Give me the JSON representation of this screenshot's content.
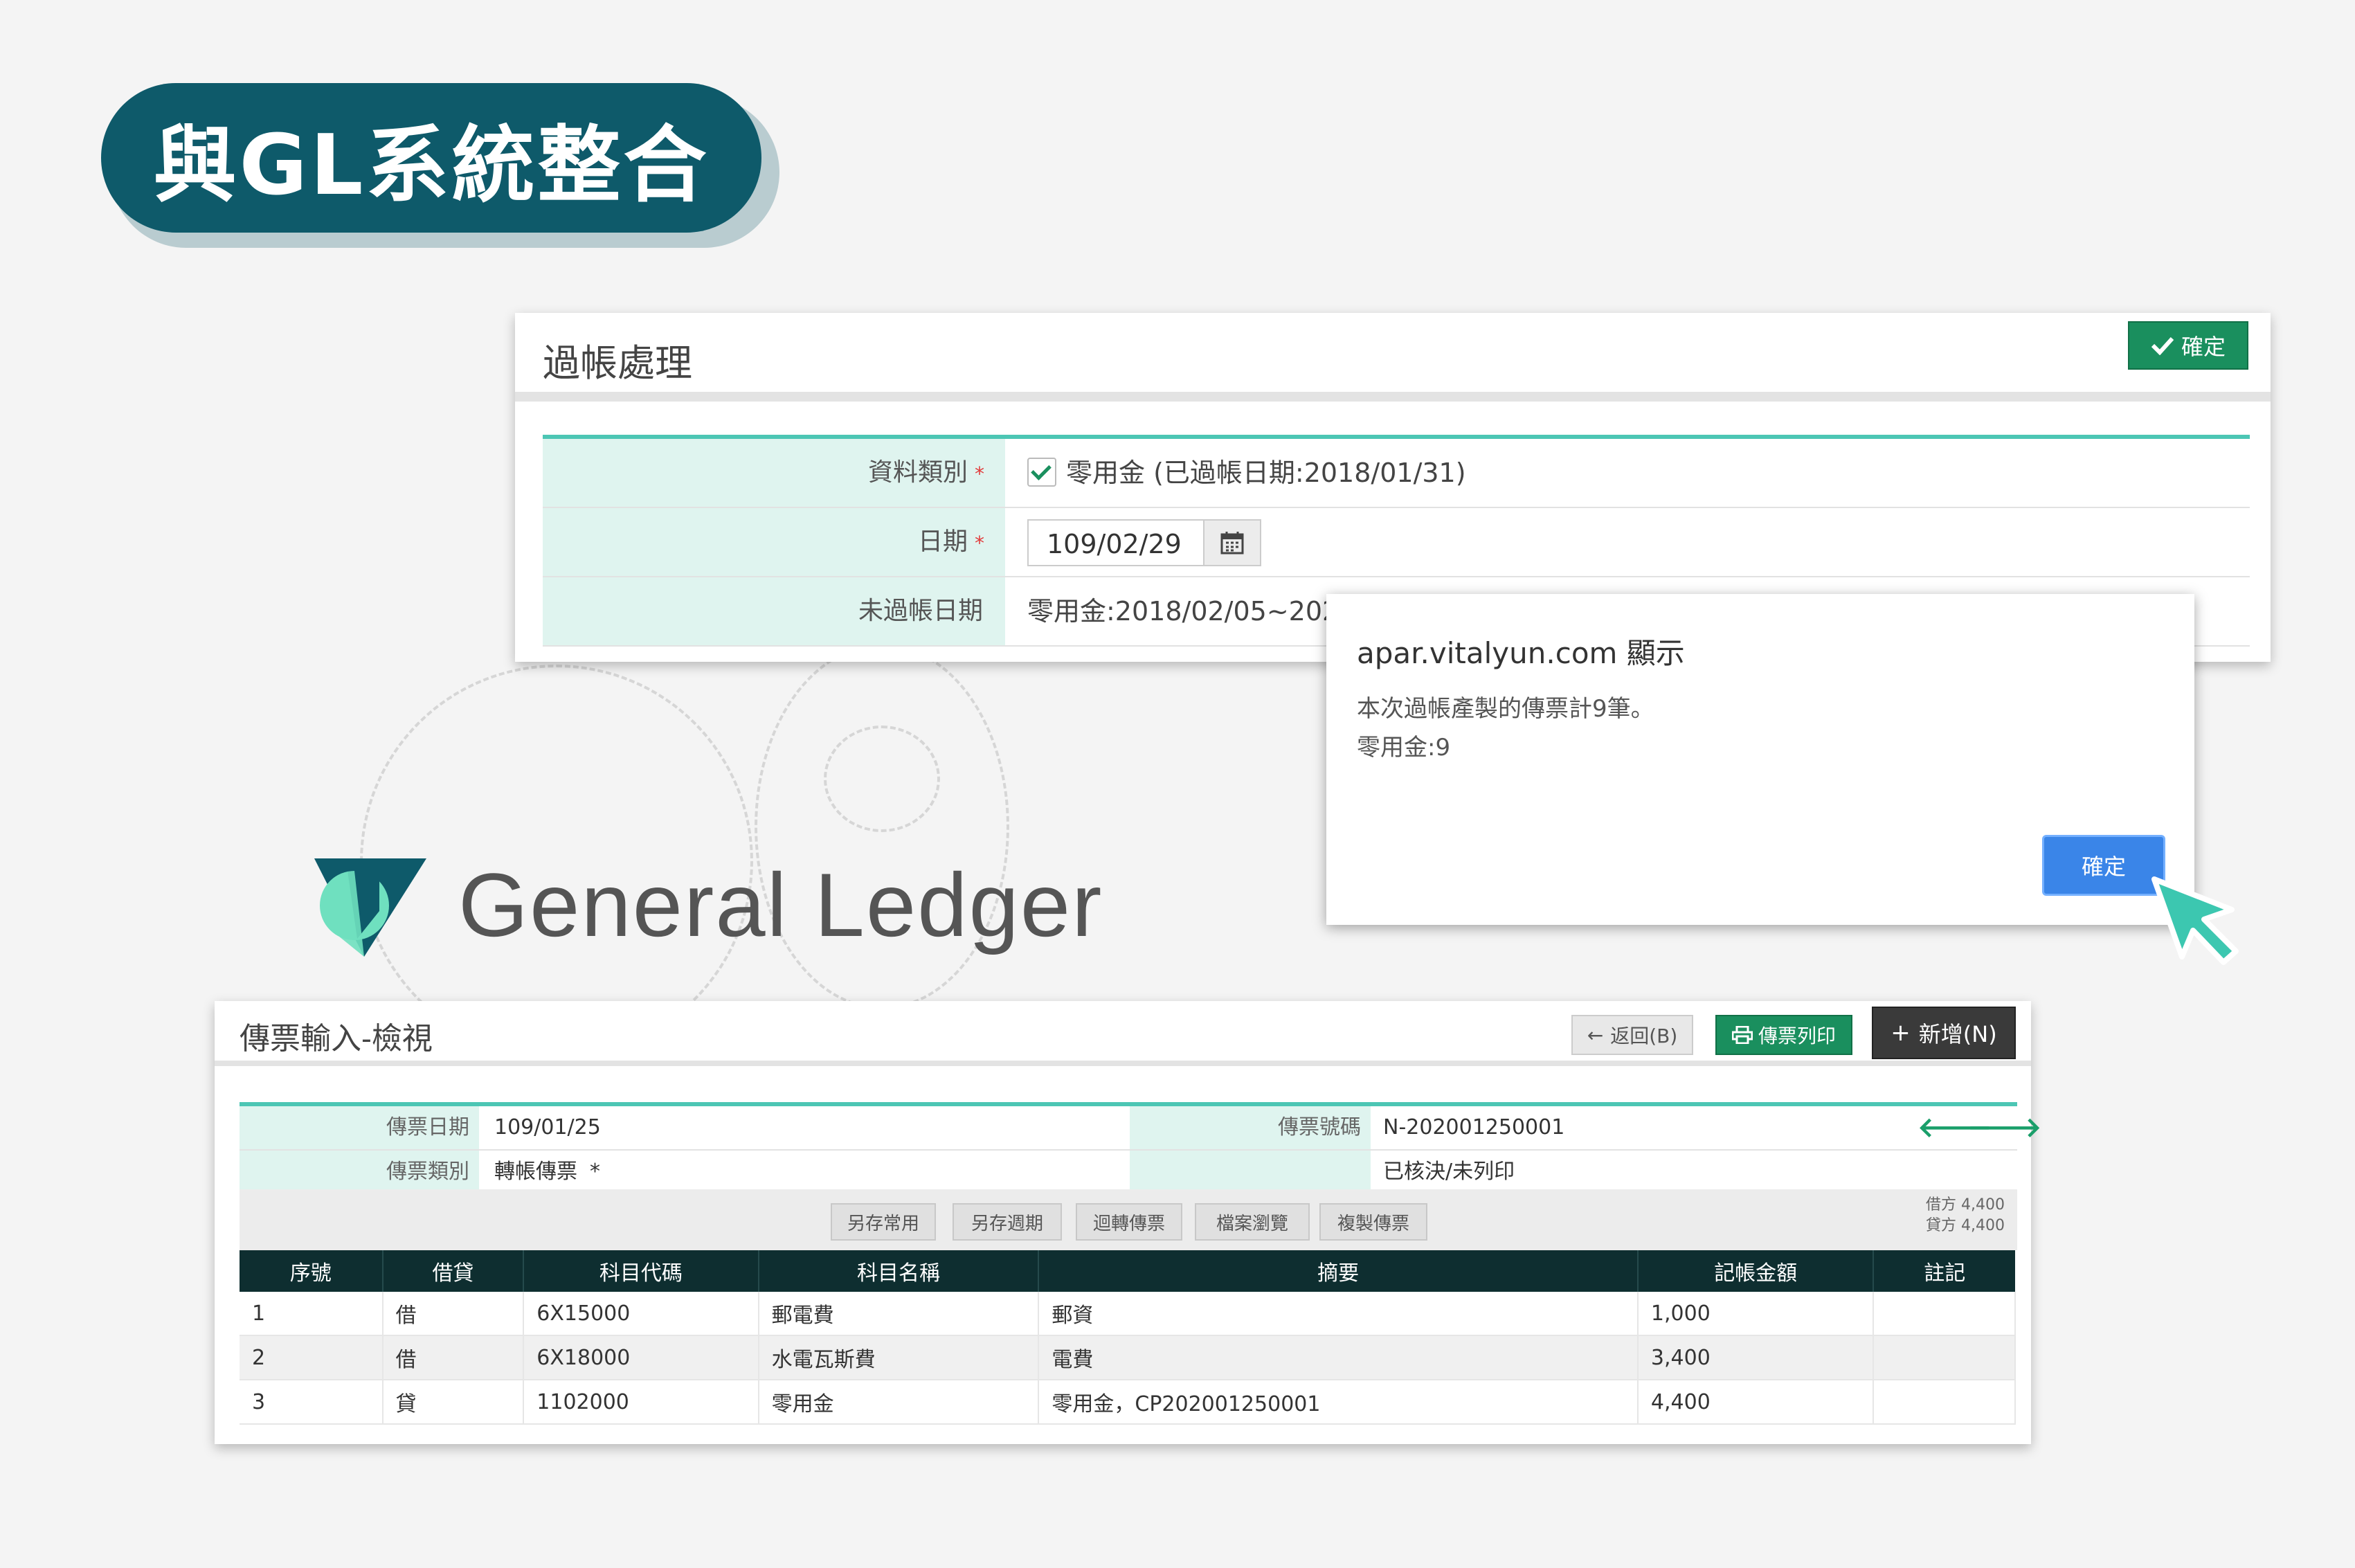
{
  "banner": {
    "title": "與GL系統整合"
  },
  "posting_panel": {
    "title": "過帳處理",
    "confirm_button": "確定",
    "fields": [
      {
        "label": "資料類別",
        "required": true,
        "value": "零用金 (已過帳日期:2018/01/31)",
        "checked": true
      },
      {
        "label": "日期",
        "required": true,
        "value": "109/02/29"
      },
      {
        "label": "未過帳日期",
        "required": false,
        "value": "零用金:2018/02/05~2020"
      }
    ]
  },
  "dialog": {
    "title": "apar.vitalyun.com 顯示",
    "message_line1": "本次過帳產製的傳票計9筆。",
    "message_line2": "零用金:9",
    "ok_button": "確定"
  },
  "logo": {
    "text": "General Ledger"
  },
  "voucher_panel": {
    "title": "傳票輸入-檢視",
    "buttons": {
      "back": "返回(B)",
      "print": "傳票列印",
      "add": "新增(N)"
    },
    "fields": {
      "date_label": "傳票日期",
      "date_value": "109/01/25",
      "number_label": "傳票號碼",
      "number_value": "N-202001250001",
      "type_label": "傳票類別",
      "type_value": "轉帳傳票",
      "type_marker": "*",
      "status_value": "已核決/未列印"
    },
    "action_buttons": [
      "另存常用",
      "另存週期",
      "迴轉傳票",
      "檔案瀏覽",
      "複製傳票"
    ],
    "totals": {
      "debit": "借方 4,400",
      "credit": "貸方 4,400"
    },
    "columns": [
      "序號",
      "借貸",
      "科目代碼",
      "科目名稱",
      "摘要",
      "記帳金額",
      "註記"
    ],
    "rows": [
      [
        "1",
        "借",
        "6X15000",
        "郵電費",
        "郵資",
        "1,000",
        ""
      ],
      [
        "2",
        "借",
        "6X18000",
        "水電瓦斯費",
        "電費",
        "3,400",
        ""
      ],
      [
        "3",
        "貸",
        "1102000",
        "零用金",
        "零用金，CP202001250001",
        "4,400",
        ""
      ]
    ]
  },
  "colors": {
    "brand_teal": "#0e5a6a",
    "accent": "#4cc6b4",
    "green_button": "#1a8f5e",
    "dialog_button": "#3a85e8"
  }
}
